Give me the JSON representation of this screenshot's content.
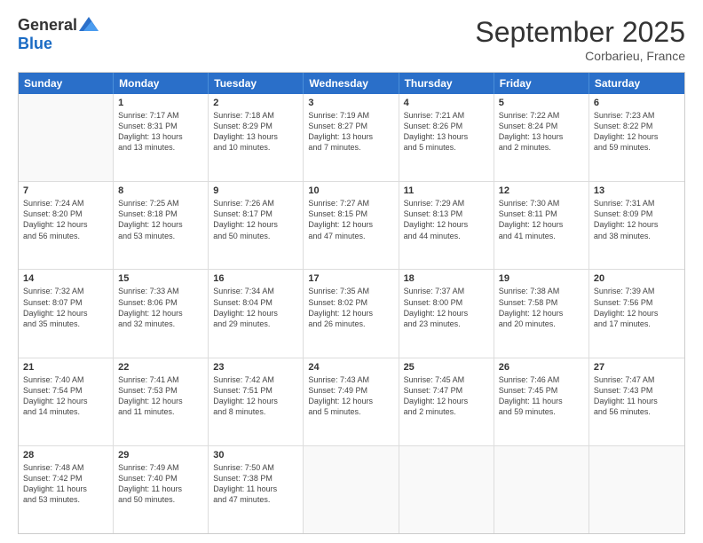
{
  "header": {
    "logo": {
      "general": "General",
      "blue": "Blue"
    },
    "title": "September 2025",
    "location": "Corbarieu, France"
  },
  "weekdays": [
    "Sunday",
    "Monday",
    "Tuesday",
    "Wednesday",
    "Thursday",
    "Friday",
    "Saturday"
  ],
  "rows": [
    [
      {
        "day": "",
        "lines": []
      },
      {
        "day": "1",
        "lines": [
          "Sunrise: 7:17 AM",
          "Sunset: 8:31 PM",
          "Daylight: 13 hours",
          "and 13 minutes."
        ]
      },
      {
        "day": "2",
        "lines": [
          "Sunrise: 7:18 AM",
          "Sunset: 8:29 PM",
          "Daylight: 13 hours",
          "and 10 minutes."
        ]
      },
      {
        "day": "3",
        "lines": [
          "Sunrise: 7:19 AM",
          "Sunset: 8:27 PM",
          "Daylight: 13 hours",
          "and 7 minutes."
        ]
      },
      {
        "day": "4",
        "lines": [
          "Sunrise: 7:21 AM",
          "Sunset: 8:26 PM",
          "Daylight: 13 hours",
          "and 5 minutes."
        ]
      },
      {
        "day": "5",
        "lines": [
          "Sunrise: 7:22 AM",
          "Sunset: 8:24 PM",
          "Daylight: 13 hours",
          "and 2 minutes."
        ]
      },
      {
        "day": "6",
        "lines": [
          "Sunrise: 7:23 AM",
          "Sunset: 8:22 PM",
          "Daylight: 12 hours",
          "and 59 minutes."
        ]
      }
    ],
    [
      {
        "day": "7",
        "lines": [
          "Sunrise: 7:24 AM",
          "Sunset: 8:20 PM",
          "Daylight: 12 hours",
          "and 56 minutes."
        ]
      },
      {
        "day": "8",
        "lines": [
          "Sunrise: 7:25 AM",
          "Sunset: 8:18 PM",
          "Daylight: 12 hours",
          "and 53 minutes."
        ]
      },
      {
        "day": "9",
        "lines": [
          "Sunrise: 7:26 AM",
          "Sunset: 8:17 PM",
          "Daylight: 12 hours",
          "and 50 minutes."
        ]
      },
      {
        "day": "10",
        "lines": [
          "Sunrise: 7:27 AM",
          "Sunset: 8:15 PM",
          "Daylight: 12 hours",
          "and 47 minutes."
        ]
      },
      {
        "day": "11",
        "lines": [
          "Sunrise: 7:29 AM",
          "Sunset: 8:13 PM",
          "Daylight: 12 hours",
          "and 44 minutes."
        ]
      },
      {
        "day": "12",
        "lines": [
          "Sunrise: 7:30 AM",
          "Sunset: 8:11 PM",
          "Daylight: 12 hours",
          "and 41 minutes."
        ]
      },
      {
        "day": "13",
        "lines": [
          "Sunrise: 7:31 AM",
          "Sunset: 8:09 PM",
          "Daylight: 12 hours",
          "and 38 minutes."
        ]
      }
    ],
    [
      {
        "day": "14",
        "lines": [
          "Sunrise: 7:32 AM",
          "Sunset: 8:07 PM",
          "Daylight: 12 hours",
          "and 35 minutes."
        ]
      },
      {
        "day": "15",
        "lines": [
          "Sunrise: 7:33 AM",
          "Sunset: 8:06 PM",
          "Daylight: 12 hours",
          "and 32 minutes."
        ]
      },
      {
        "day": "16",
        "lines": [
          "Sunrise: 7:34 AM",
          "Sunset: 8:04 PM",
          "Daylight: 12 hours",
          "and 29 minutes."
        ]
      },
      {
        "day": "17",
        "lines": [
          "Sunrise: 7:35 AM",
          "Sunset: 8:02 PM",
          "Daylight: 12 hours",
          "and 26 minutes."
        ]
      },
      {
        "day": "18",
        "lines": [
          "Sunrise: 7:37 AM",
          "Sunset: 8:00 PM",
          "Daylight: 12 hours",
          "and 23 minutes."
        ]
      },
      {
        "day": "19",
        "lines": [
          "Sunrise: 7:38 AM",
          "Sunset: 7:58 PM",
          "Daylight: 12 hours",
          "and 20 minutes."
        ]
      },
      {
        "day": "20",
        "lines": [
          "Sunrise: 7:39 AM",
          "Sunset: 7:56 PM",
          "Daylight: 12 hours",
          "and 17 minutes."
        ]
      }
    ],
    [
      {
        "day": "21",
        "lines": [
          "Sunrise: 7:40 AM",
          "Sunset: 7:54 PM",
          "Daylight: 12 hours",
          "and 14 minutes."
        ]
      },
      {
        "day": "22",
        "lines": [
          "Sunrise: 7:41 AM",
          "Sunset: 7:53 PM",
          "Daylight: 12 hours",
          "and 11 minutes."
        ]
      },
      {
        "day": "23",
        "lines": [
          "Sunrise: 7:42 AM",
          "Sunset: 7:51 PM",
          "Daylight: 12 hours",
          "and 8 minutes."
        ]
      },
      {
        "day": "24",
        "lines": [
          "Sunrise: 7:43 AM",
          "Sunset: 7:49 PM",
          "Daylight: 12 hours",
          "and 5 minutes."
        ]
      },
      {
        "day": "25",
        "lines": [
          "Sunrise: 7:45 AM",
          "Sunset: 7:47 PM",
          "Daylight: 12 hours",
          "and 2 minutes."
        ]
      },
      {
        "day": "26",
        "lines": [
          "Sunrise: 7:46 AM",
          "Sunset: 7:45 PM",
          "Daylight: 11 hours",
          "and 59 minutes."
        ]
      },
      {
        "day": "27",
        "lines": [
          "Sunrise: 7:47 AM",
          "Sunset: 7:43 PM",
          "Daylight: 11 hours",
          "and 56 minutes."
        ]
      }
    ],
    [
      {
        "day": "28",
        "lines": [
          "Sunrise: 7:48 AM",
          "Sunset: 7:42 PM",
          "Daylight: 11 hours",
          "and 53 minutes."
        ]
      },
      {
        "day": "29",
        "lines": [
          "Sunrise: 7:49 AM",
          "Sunset: 7:40 PM",
          "Daylight: 11 hours",
          "and 50 minutes."
        ]
      },
      {
        "day": "30",
        "lines": [
          "Sunrise: 7:50 AM",
          "Sunset: 7:38 PM",
          "Daylight: 11 hours",
          "and 47 minutes."
        ]
      },
      {
        "day": "",
        "lines": []
      },
      {
        "day": "",
        "lines": []
      },
      {
        "day": "",
        "lines": []
      },
      {
        "day": "",
        "lines": []
      }
    ]
  ]
}
